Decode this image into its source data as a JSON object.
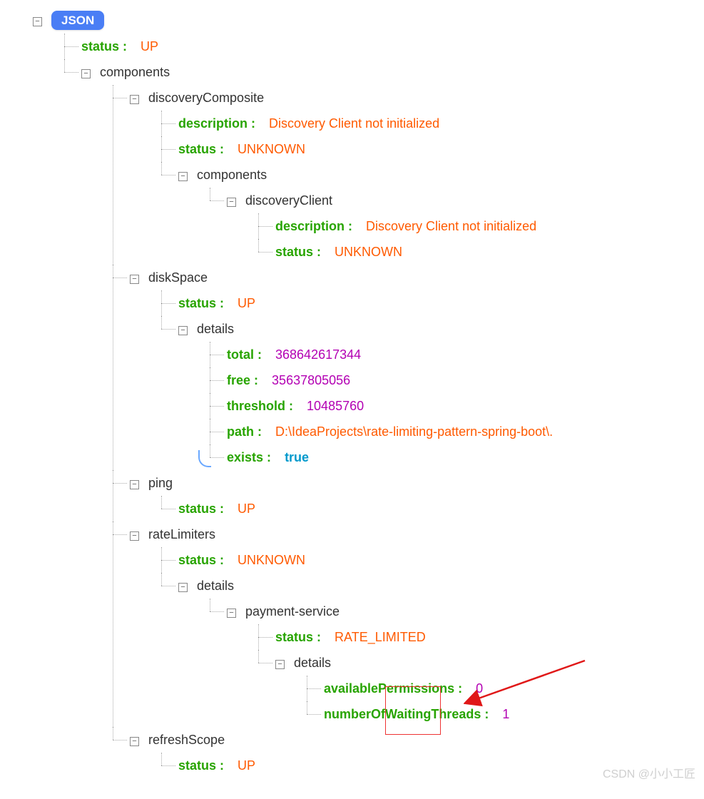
{
  "root": {
    "badge": "JSON"
  },
  "status": {
    "key": "status",
    "value": "UP"
  },
  "components": {
    "label": "components",
    "discoveryComposite": {
      "label": "discoveryComposite",
      "description": {
        "key": "description",
        "value": "Discovery Client not initialized"
      },
      "status": {
        "key": "status",
        "value": "UNKNOWN"
      },
      "components": {
        "label": "components",
        "discoveryClient": {
          "label": "discoveryClient",
          "description": {
            "key": "description",
            "value": "Discovery Client not initialized"
          },
          "status": {
            "key": "status",
            "value": "UNKNOWN"
          }
        }
      }
    },
    "diskSpace": {
      "label": "diskSpace",
      "status": {
        "key": "status",
        "value": "UP"
      },
      "details": {
        "label": "details",
        "total": {
          "key": "total",
          "value": "368642617344"
        },
        "free": {
          "key": "free",
          "value": "35637805056"
        },
        "threshold": {
          "key": "threshold",
          "value": "10485760"
        },
        "path": {
          "key": "path",
          "value": "D:\\IdeaProjects\\rate-limiting-pattern-spring-boot\\."
        },
        "exists": {
          "key": "exists",
          "value": "true"
        }
      }
    },
    "ping": {
      "label": "ping",
      "status": {
        "key": "status",
        "value": "UP"
      }
    },
    "rateLimiters": {
      "label": "rateLimiters",
      "status": {
        "key": "status",
        "value": "UNKNOWN"
      },
      "details": {
        "label": "details",
        "paymentService": {
          "label": "payment-service",
          "status": {
            "key": "status",
            "value": "RATE_LIMITED"
          },
          "details": {
            "label": "details",
            "availablePermissions": {
              "key": "availablePermissions",
              "value": "0"
            },
            "numberOfWaitingThreads": {
              "key": "numberOfWaitingThreads",
              "value": "1"
            }
          }
        }
      }
    },
    "refreshScope": {
      "label": "refreshScope",
      "status": {
        "key": "status",
        "value": "UP"
      }
    }
  },
  "watermark": "CSDN @小小工匠"
}
